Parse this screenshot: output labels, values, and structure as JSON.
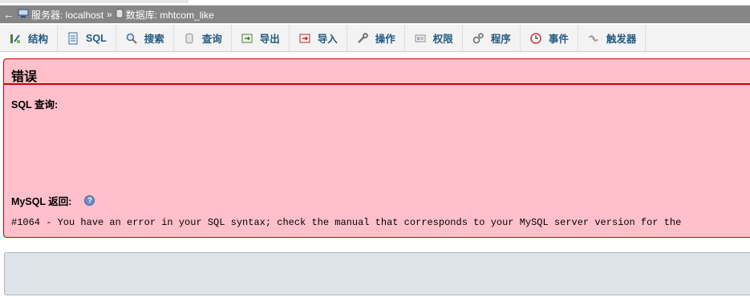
{
  "breadcrumb": {
    "back": "←",
    "server_label": "服务器: localhost",
    "separator": "»",
    "database_label": "数据库: mhtcom_like"
  },
  "tabs": [
    {
      "label": "结构",
      "icon": "structure-icon"
    },
    {
      "label": "SQL",
      "icon": "sql-icon"
    },
    {
      "label": "搜索",
      "icon": "search-icon"
    },
    {
      "label": "查询",
      "icon": "query-icon"
    },
    {
      "label": "导出",
      "icon": "export-icon"
    },
    {
      "label": "导入",
      "icon": "import-icon"
    },
    {
      "label": "操作",
      "icon": "operations-icon"
    },
    {
      "label": "权限",
      "icon": "privileges-icon"
    },
    {
      "label": "程序",
      "icon": "routines-icon"
    },
    {
      "label": "事件",
      "icon": "events-icon"
    },
    {
      "label": "触发器",
      "icon": "triggers-icon"
    }
  ],
  "error": {
    "title": "错误",
    "sql_label": "SQL 查询:",
    "mysql_label": "MySQL 返回:",
    "message": "#1064 - You have an error in your SQL syntax; check the manual that corresponds to your MySQL server version for the"
  },
  "colors": {
    "error_bg": "#ffc0cb",
    "error_border": "#cc0000",
    "tab_text": "#235a81",
    "breadcrumb_bg": "#868686"
  }
}
